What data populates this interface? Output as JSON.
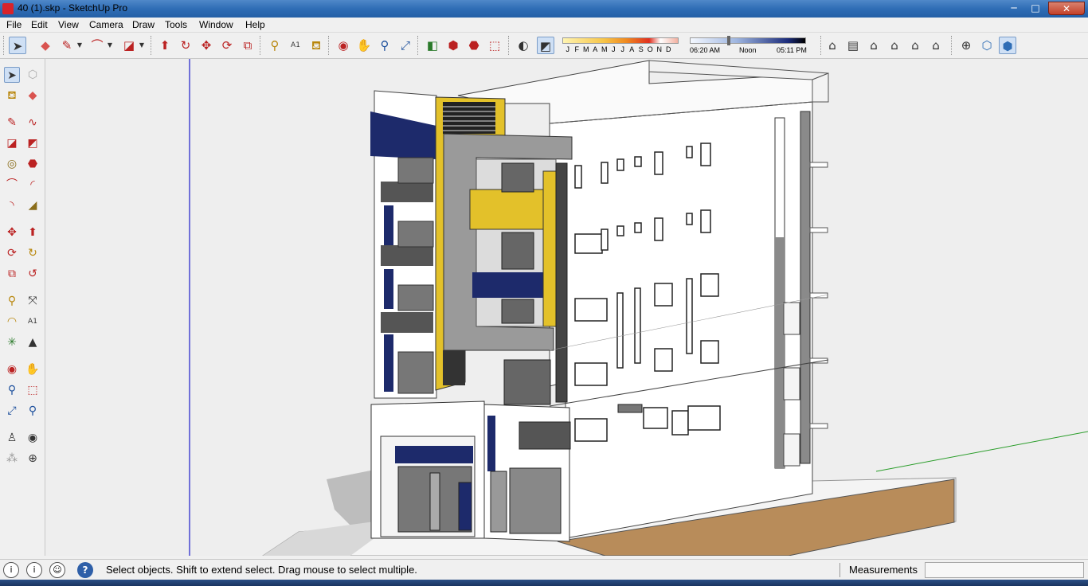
{
  "window": {
    "title": "40 (1).skp - SketchUp Pro",
    "minimize": "─",
    "maximize": "□",
    "close": "✕"
  },
  "menu": [
    "File",
    "Edit",
    "View",
    "Camera",
    "Draw",
    "Tools",
    "Window",
    "Help"
  ],
  "toolbar": {
    "icons": [
      "select-icon",
      "eraser-icon",
      "pencil-icon",
      "arc-icon",
      "rectangle-icon",
      "push-pull-icon",
      "follow-me-icon",
      "move-icon",
      "rotate-icon",
      "scale-icon",
      "tape-measure-icon",
      "text-icon",
      "paint-bucket-icon",
      "orbit-icon",
      "pan-icon",
      "zoom-icon",
      "zoom-extents-icon",
      "section-plane-icon",
      "component-icon",
      "materials-icon",
      "warehouse-icon",
      "shadows-icon",
      "fog-icon",
      "iso-view-icon",
      "top-view-icon",
      "front-view-icon",
      "right-view-icon",
      "back-view-icon",
      "left-view-icon",
      "xray-icon",
      "wireframe-icon",
      "shaded-textures-icon"
    ],
    "months": [
      "J",
      "F",
      "M",
      "A",
      "M",
      "J",
      "J",
      "A",
      "S",
      "O",
      "N",
      "D"
    ],
    "time_start": "06:20 AM",
    "time_mid": "Noon",
    "time_end": "05:11 PM"
  },
  "left_tools": [
    "select-icon",
    "component-icon",
    "paint-bucket-icon",
    "eraser-icon",
    "line-icon",
    "freehand-icon",
    "rectangle-icon",
    "rotated-rectangle-icon",
    "circle-icon",
    "polygon-icon",
    "arc-icon",
    "two-point-arc-icon",
    "three-point-arc-icon",
    "pie-icon",
    "move-icon",
    "push-pull-icon",
    "rotate-icon",
    "follow-me-icon",
    "scale-icon",
    "offset-icon",
    "tape-measure-icon",
    "dimension-icon",
    "protractor-icon",
    "text-icon",
    "axes-icon",
    "3d-text-icon",
    "orbit-icon",
    "pan-icon",
    "zoom-icon",
    "zoom-window-icon",
    "zoom-extents-icon",
    "previous-view-icon",
    "position-camera-icon",
    "look-around-icon",
    "walk-icon",
    "section-plane-icon"
  ],
  "status": {
    "message": "Select objects. Shift to extend select. Drag mouse to select multiple.",
    "measurements_label": "Measurements",
    "measurements_value": "",
    "help": "?"
  },
  "colors": {
    "titlebar": "#2f6db5",
    "accent_yellow": "#e3c12a",
    "accent_navy": "#1d2a6b",
    "ground": "#b88c5a",
    "axis_blue": "#1d1dc9",
    "axis_green": "#2a9d2a"
  }
}
